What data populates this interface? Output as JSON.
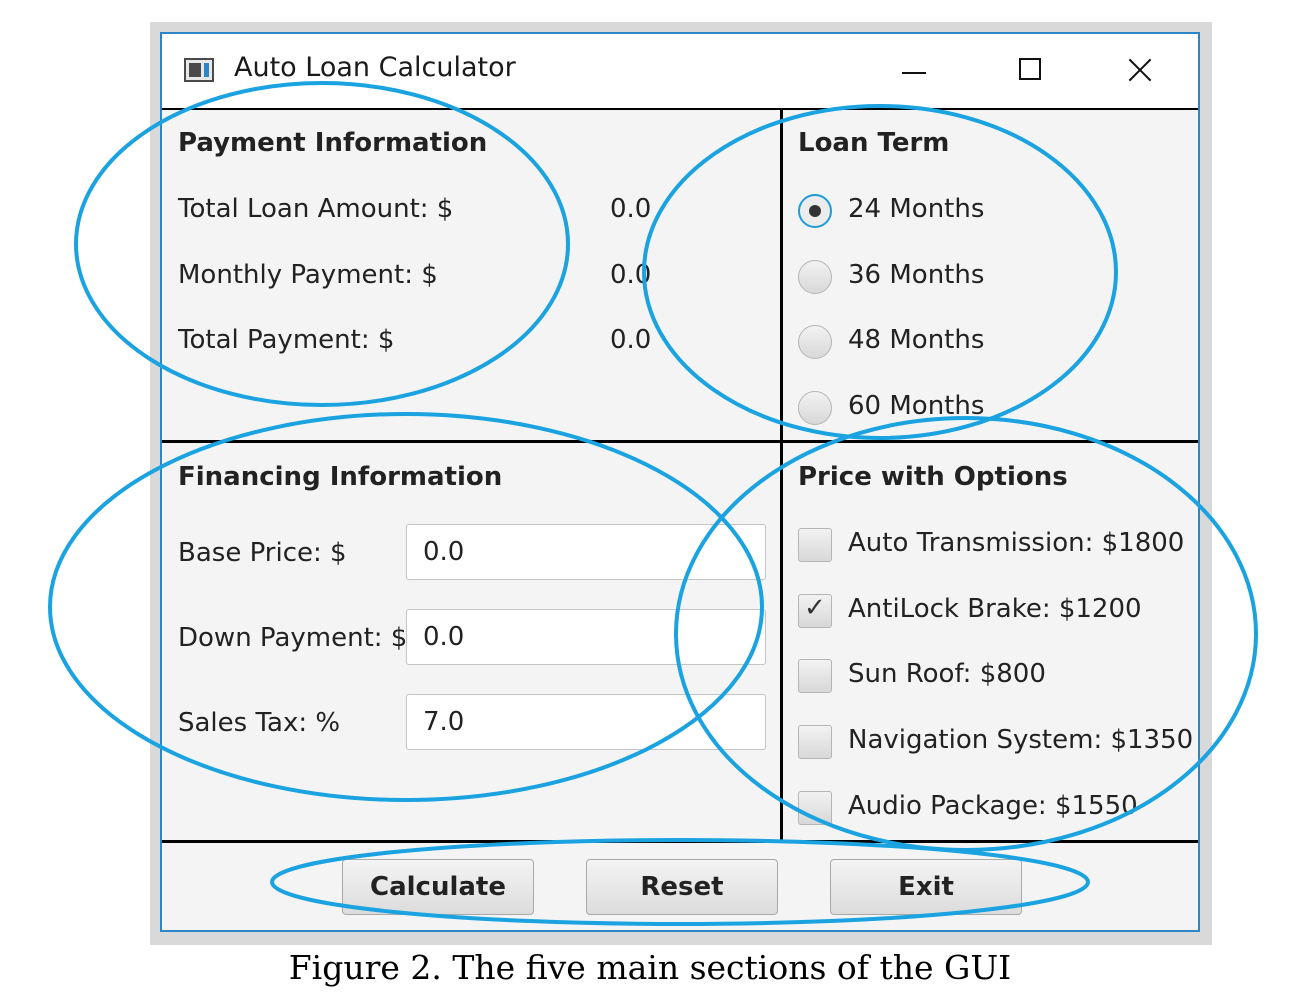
{
  "window": {
    "title": "Auto Loan Calculator"
  },
  "payment_info": {
    "title": "Payment Information",
    "rows": [
      {
        "label": "Total Loan Amount: $",
        "value": "0.0"
      },
      {
        "label": "Monthly Payment: $",
        "value": "0.0"
      },
      {
        "label": "Total Payment: $",
        "value": "0.0"
      }
    ]
  },
  "loan_term": {
    "title": "Loan Term",
    "options": [
      "24 Months",
      "36 Months",
      "48 Months",
      "60 Months"
    ],
    "selected": "24 Months"
  },
  "financing_info": {
    "title": "Financing Information",
    "fields": [
      {
        "label": "Base Price: $",
        "value": "0.0"
      },
      {
        "label": "Down Payment: $",
        "value": "0.0"
      },
      {
        "label": "Sales Tax: %",
        "value": "7.0"
      }
    ]
  },
  "price_options": {
    "title": "Price with Options",
    "items": [
      {
        "label": "Auto Transmission: $1800",
        "checked": false
      },
      {
        "label": "AntiLock Brake: $1200",
        "checked": true
      },
      {
        "label": "Sun Roof: $800",
        "checked": false
      },
      {
        "label": "Navigation System: $1350",
        "checked": false
      },
      {
        "label": "Audio Package: $1550",
        "checked": false
      }
    ]
  },
  "buttons": {
    "calculate": "Calculate",
    "reset": "Reset",
    "exit": "Exit"
  },
  "caption": "Figure 2. The five main sections of the GUI",
  "colors": {
    "annotation": "#1aa3e0",
    "window_border": "#2e86c9"
  }
}
